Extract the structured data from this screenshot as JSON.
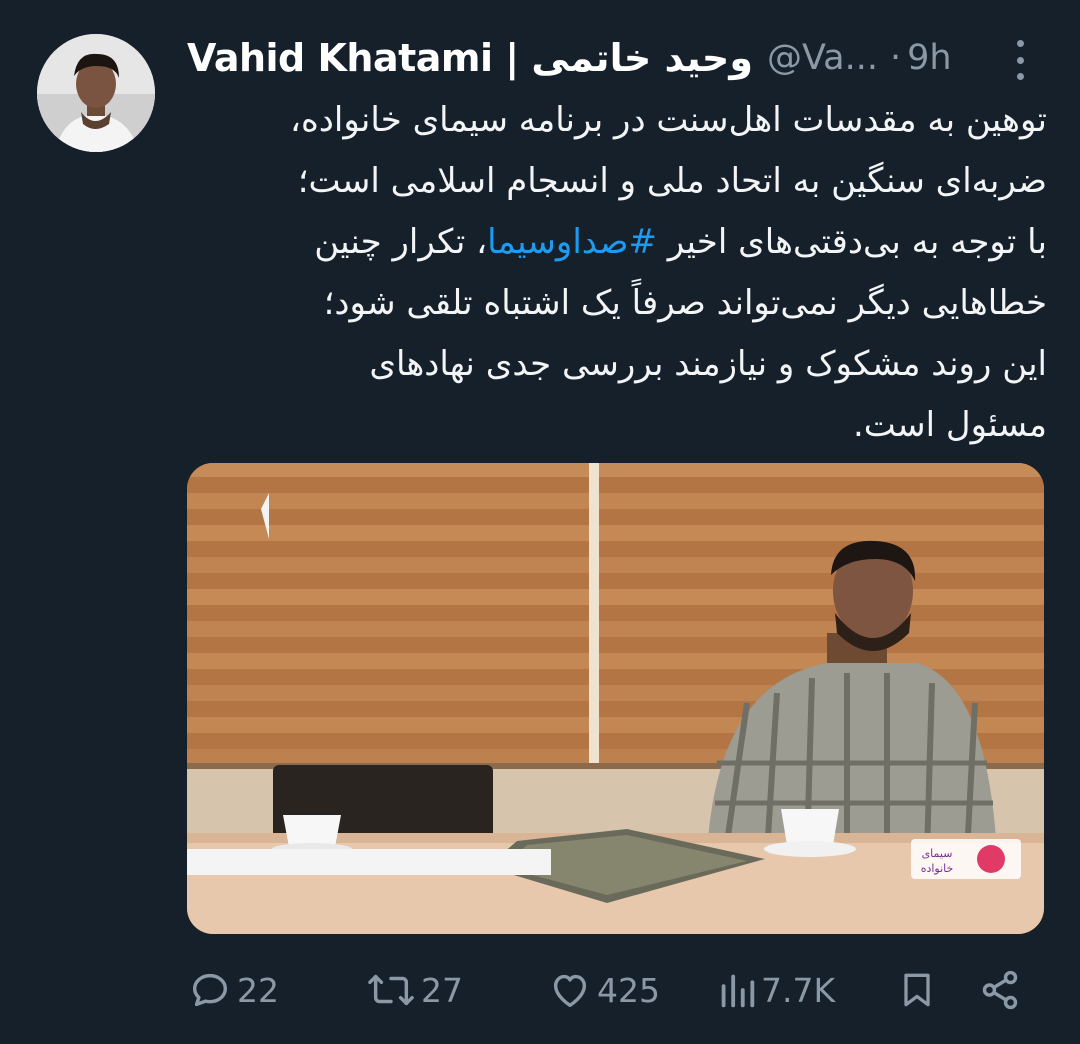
{
  "author": {
    "name": "Vahid Khatami | وحید خاتمی",
    "handle": "@Va...",
    "separator": "·",
    "time": "9h"
  },
  "tweet": {
    "lines": [
      "توهین به مقدسات اهل‌سنت در برنامه سیمای خانواده،",
      "ضربه‌ای سنگین به اتحاد ملی و انسجام اسلامی است؛",
      "تکرار چنین",
      "خطاهایی دیگر نمی‌تواند صرفاً یک اشتباه تلقی شود؛",
      "این روند مشکوک و نیازمند بررسی جدی نهادهای",
      "مسئول است."
    ],
    "line3_before": "با توجه به بی‌دقتی‌های اخیر ",
    "hashtag": "#صداوسیما",
    "line3_after": "، "
  },
  "media": {
    "logo_text_top": "سیمای",
    "logo_text_bottom": "خانواده"
  },
  "actions": {
    "replies": "22",
    "retweets": "27",
    "likes": "425",
    "views": "7.7K"
  },
  "icons": {
    "reply": "reply-icon",
    "retweet": "retweet-icon",
    "like": "heart-icon",
    "views": "views-icon",
    "bookmark": "bookmark-icon",
    "share": "share-icon",
    "more": "more-icon"
  },
  "colors": {
    "background": "#15202b",
    "text": "#ffffff",
    "muted": "#8b98a5",
    "link": "#1d9bf0"
  }
}
